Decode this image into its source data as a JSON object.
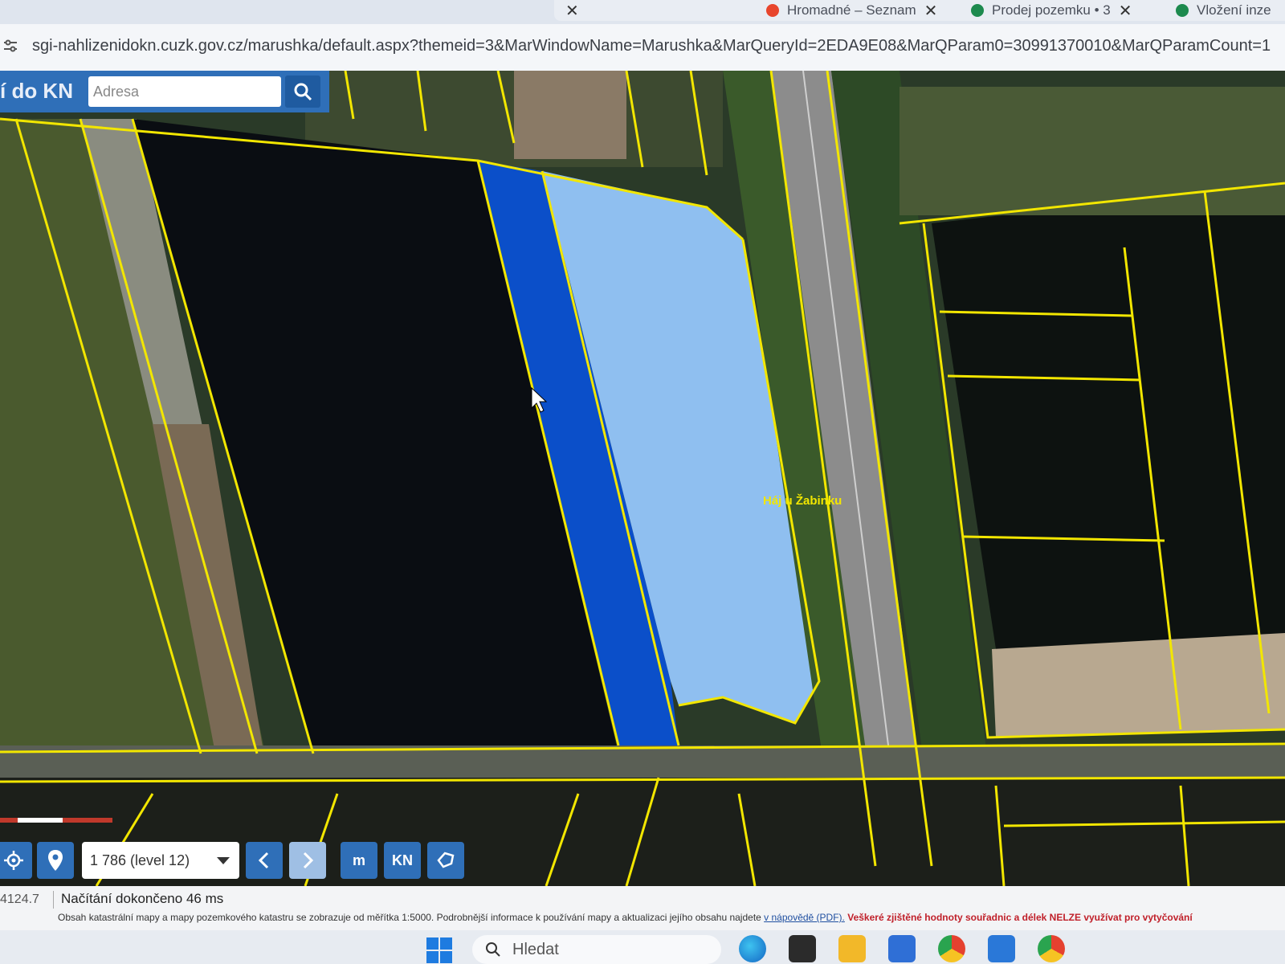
{
  "browser": {
    "tabs": [
      {
        "label": "Hromadné – Seznam",
        "close": "✕"
      },
      {
        "label": "Prodej pozemku • 3",
        "close": "✕"
      },
      {
        "label": "Vložení inze",
        "close": ""
      }
    ],
    "url": "sgi-nahlizenidokn.cuzk.gov.cz/marushka/default.aspx?themeid=3&MarWindowName=Marushka&MarQueryId=2EDA9E08&MarQParam0=30991370010&MarQParamCount=1"
  },
  "app": {
    "title": "í do KN",
    "search_placeholder": "Adresa"
  },
  "map": {
    "place_label": "Háj u Žabinku",
    "colors": {
      "parcel_line": "#f2e600",
      "selection_dark": "#0b4fc9",
      "selection_light": "#8fbff0"
    }
  },
  "toolbar": {
    "scale_value": "1 786 (level 12)",
    "measure_label": "m",
    "kn_label": "KN"
  },
  "status": {
    "coordinate": "4124.7",
    "loading": "Načítání dokončeno 46 ms",
    "note_prefix": "Obsah katastrální mapy a mapy pozemkového katastru se zobrazuje od měřítka 1:5000. Podrobnější informace k používání mapy a aktualizaci jejího obsahu najdete",
    "note_link": "v nápovědě (PDF).",
    "note_warning": "Veškeré zjištěné hodnoty souřadnic a délek NELZE využívat pro vytyčování"
  },
  "taskbar": {
    "search_label": "Hledat",
    "apps": [
      "windows-start-icon",
      "edge-icon",
      "notion-icon",
      "file-explorer-icon",
      "store-icon",
      "chrome-icon",
      "mail-icon",
      "chrome-profile-icon"
    ]
  }
}
